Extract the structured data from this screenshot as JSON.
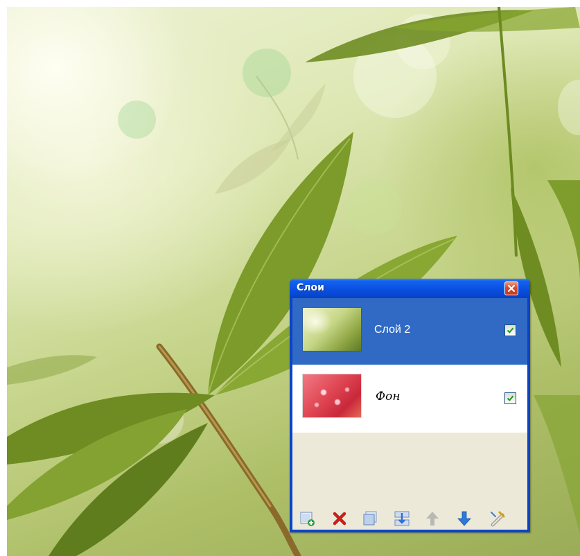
{
  "window": {
    "title": "Слои",
    "close_icon": "close-icon"
  },
  "layers": [
    {
      "name": "Слой 2",
      "selected": true,
      "visible": true,
      "thumbnail": "green-leaves"
    },
    {
      "name": "Фон",
      "selected": false,
      "visible": true,
      "thumbnail": "red-texture"
    }
  ],
  "toolbar": {
    "buttons": [
      {
        "icon": "add-layer-icon"
      },
      {
        "icon": "delete-layer-icon"
      },
      {
        "icon": "duplicate-layer-icon"
      },
      {
        "icon": "merge-layer-down-icon"
      },
      {
        "icon": "move-layer-up-icon"
      },
      {
        "icon": "move-layer-down-icon"
      },
      {
        "icon": "layer-properties-icon"
      }
    ]
  },
  "colors": {
    "title_bar": "#0a50df",
    "selected_row": "#316ac5",
    "panel_background": "#ece9d8",
    "close_button": "#d6492b"
  }
}
